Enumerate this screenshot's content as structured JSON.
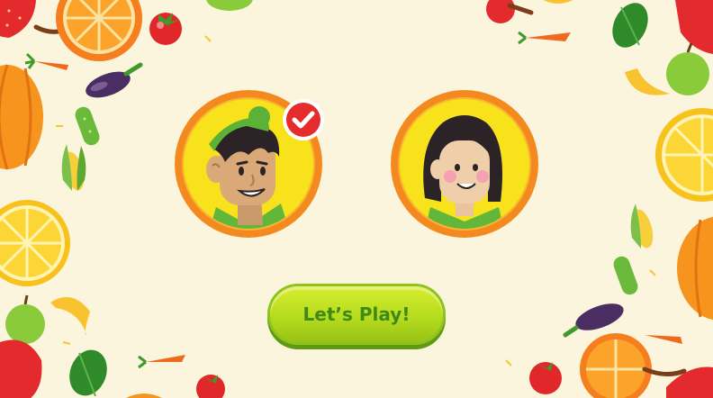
{
  "screen": "character-select",
  "characters": [
    {
      "id": "boy",
      "icon": "boy-avatar-icon",
      "selected": true
    },
    {
      "id": "girl",
      "icon": "girl-avatar-icon",
      "selected": false
    }
  ],
  "selected_badge_icon": "checkmark-icon",
  "play_button": {
    "label": "Let’s Play!"
  },
  "colors": {
    "background": "#fbf5dd",
    "avatar_ring": "#f48a1f",
    "avatar_fill": "#f7e21c",
    "check_badge": "#e52b2b",
    "button_fill": "#c4e228",
    "button_text": "#3f8a15"
  }
}
